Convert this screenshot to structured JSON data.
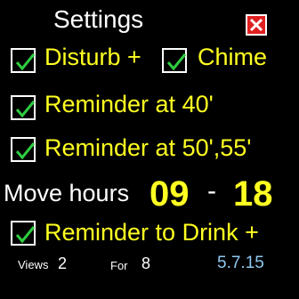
{
  "title": "Settings",
  "close": {
    "icon": "close-x-icon",
    "color": "#e02020"
  },
  "checkboxes": [
    {
      "label": "Disturb +",
      "checked": true
    },
    {
      "label": "Chime",
      "checked": true
    },
    {
      "label": "Reminder at 40'",
      "checked": true
    },
    {
      "label": "Reminder at 50',55'",
      "checked": true
    },
    {
      "label": "Reminder to Drink +",
      "checked": true
    }
  ],
  "move_hours": {
    "label": "Move hours",
    "start": "09",
    "separator": "-",
    "end": "18"
  },
  "footer": {
    "views_label": "Views",
    "views_value": "2",
    "for_label": "For",
    "for_value": "8",
    "version": "5.7.15"
  },
  "colors": {
    "background": "#000000",
    "label_yellow": "#ffff22",
    "check_green": "#2ecc40",
    "version_blue": "#8fc8f0"
  }
}
